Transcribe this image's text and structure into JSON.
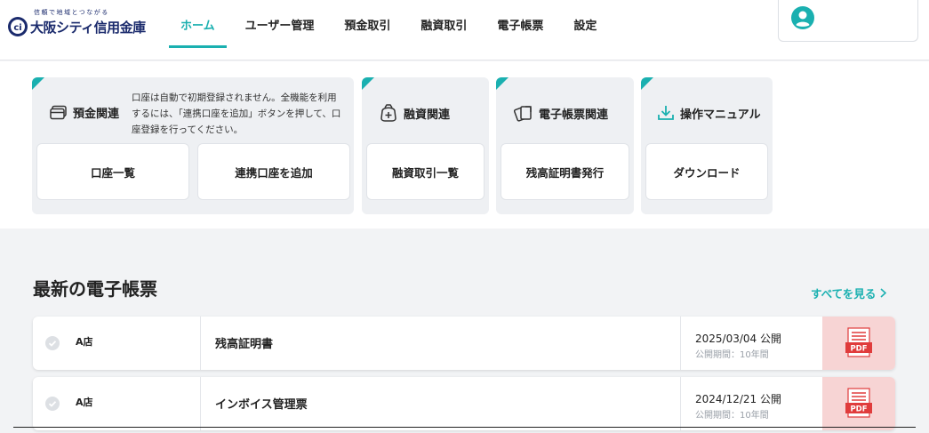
{
  "brand": {
    "tagline": "信頼で地域とつながる",
    "name": "大阪シティ信用金庫"
  },
  "nav": [
    {
      "label": "ホーム",
      "active": true
    },
    {
      "label": "ユーザー管理",
      "active": false
    },
    {
      "label": "預金取引",
      "active": false
    },
    {
      "label": "融資取引",
      "active": false
    },
    {
      "label": "電子帳票",
      "active": false
    },
    {
      "label": "設定",
      "active": false
    }
  ],
  "user": {
    "icon": "user-circle-icon"
  },
  "cards": {
    "deposit": {
      "title": "預金関連",
      "icon": "card-icon",
      "description": "口座は自動で初期登録されません。全機能を利用するには、「連携口座を追加」ボタンを押して、口座登録を行ってください。",
      "buttons": [
        "口座一覧",
        "連携口座を追加"
      ]
    },
    "loan": {
      "title": "融資関連",
      "icon": "loan-bag-icon",
      "buttons": [
        "融資取引一覧"
      ]
    },
    "edoc": {
      "title": "電子帳票関連",
      "icon": "documents-icon",
      "buttons": [
        "残高証明書発行"
      ]
    },
    "manual": {
      "title": "操作マニュアル",
      "icon": "download-icon",
      "buttons": [
        "ダウンロード"
      ]
    }
  },
  "latest": {
    "title": "最新の電子帳票",
    "see_all": "すべてを見る",
    "rows": [
      {
        "branch": "A店",
        "name": "残高証明書",
        "date": "2025/03/04 公開",
        "period": "公開期間：10年間",
        "file": "PDF"
      },
      {
        "branch": "A店",
        "name": "インボイス管理票",
        "date": "2024/12/21 公開",
        "period": "公開期間：10年間",
        "file": "PDF"
      }
    ]
  },
  "colors": {
    "accent": "#1ab0b0",
    "brand": "#1a2a6c",
    "pdf_red": "#e03c3c",
    "pdf_bg": "#f7d4d4"
  }
}
